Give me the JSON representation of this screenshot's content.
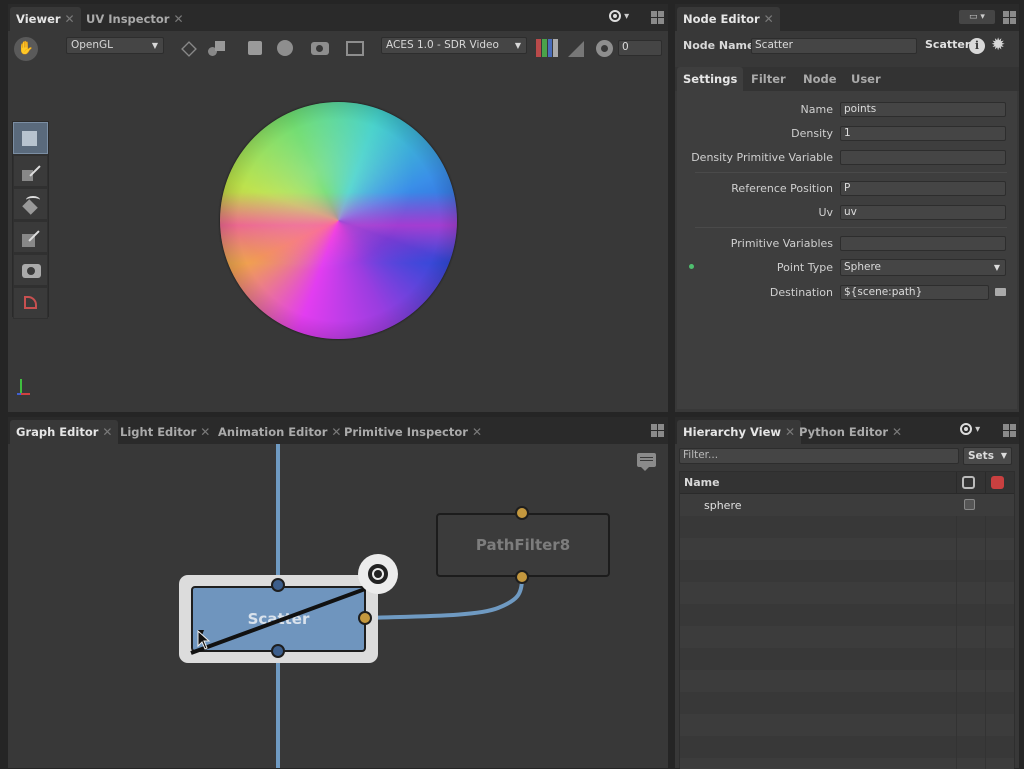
{
  "viewer": {
    "tabs": [
      {
        "label": "Viewer"
      },
      {
        "label": "UV Inspector"
      }
    ],
    "renderer": "OpenGL",
    "color_space": "ACES 1.0 - SDR Video",
    "exposure": "0"
  },
  "node_editor": {
    "tab": "Node Editor",
    "node_name_label": "Node Name",
    "node_name_value": "Scatter",
    "node_type": "Scatter",
    "subtabs": [
      {
        "label": "Settings"
      },
      {
        "label": "Filter"
      },
      {
        "label": "Node"
      },
      {
        "label": "User"
      }
    ],
    "params": {
      "name": {
        "label": "Name",
        "value": "points"
      },
      "density": {
        "label": "Density",
        "value": "1"
      },
      "density_pv": {
        "label": "Density Primitive Variable",
        "value": ""
      },
      "ref_pos": {
        "label": "Reference Position",
        "value": "P"
      },
      "uv": {
        "label": "Uv",
        "value": "uv"
      },
      "prim_vars": {
        "label": "Primitive Variables",
        "value": ""
      },
      "point_type": {
        "label": "Point Type",
        "value": "Sphere"
      },
      "destination": {
        "label": "Destination",
        "value": "${scene:path}"
      }
    }
  },
  "graph_editor": {
    "tabs": [
      {
        "label": "Graph Editor"
      },
      {
        "label": "Light Editor"
      },
      {
        "label": "Animation Editor"
      },
      {
        "label": "Primitive Inspector"
      }
    ],
    "nodes": {
      "scatter": "Scatter",
      "pathfilter": "PathFilter8"
    }
  },
  "hierarchy": {
    "tabs": [
      {
        "label": "Hierarchy View"
      },
      {
        "label": "Python Editor"
      }
    ],
    "filter_placeholder": "Filter...",
    "sets_label": "Sets",
    "column_name": "Name",
    "rows": [
      {
        "name": "sphere"
      }
    ]
  },
  "colors": {
    "accent_node": "#6f95be",
    "plug_gold": "#c4983e",
    "plug_blue": "#3c5e8c",
    "connection": "#6f9ac2"
  }
}
